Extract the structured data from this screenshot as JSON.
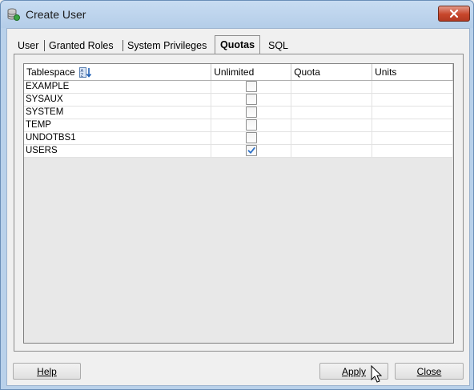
{
  "window": {
    "title": "Create User"
  },
  "tabs": [
    {
      "label": "User",
      "active": false
    },
    {
      "label": "Granted Roles",
      "active": false
    },
    {
      "label": "System Privileges",
      "active": false
    },
    {
      "label": "Quotas",
      "active": true
    },
    {
      "label": "SQL",
      "active": false
    }
  ],
  "table": {
    "columns": [
      "Tablespace",
      "Unlimited",
      "Quota",
      "Units"
    ],
    "rows": [
      {
        "tablespace": "EXAMPLE",
        "unlimited": false,
        "quota": "",
        "units": ""
      },
      {
        "tablespace": "SYSAUX",
        "unlimited": false,
        "quota": "",
        "units": ""
      },
      {
        "tablespace": "SYSTEM",
        "unlimited": false,
        "quota": "",
        "units": ""
      },
      {
        "tablespace": "TEMP",
        "unlimited": false,
        "quota": "",
        "units": ""
      },
      {
        "tablespace": "UNDOTBS1",
        "unlimited": false,
        "quota": "",
        "units": ""
      },
      {
        "tablespace": "USERS",
        "unlimited": true,
        "quota": "",
        "units": ""
      }
    ]
  },
  "buttons": {
    "help": "Help",
    "apply": "Apply",
    "close": "Close"
  },
  "colors": {
    "checkmark": "#2b6fc7",
    "close_button": "#c7462b"
  }
}
